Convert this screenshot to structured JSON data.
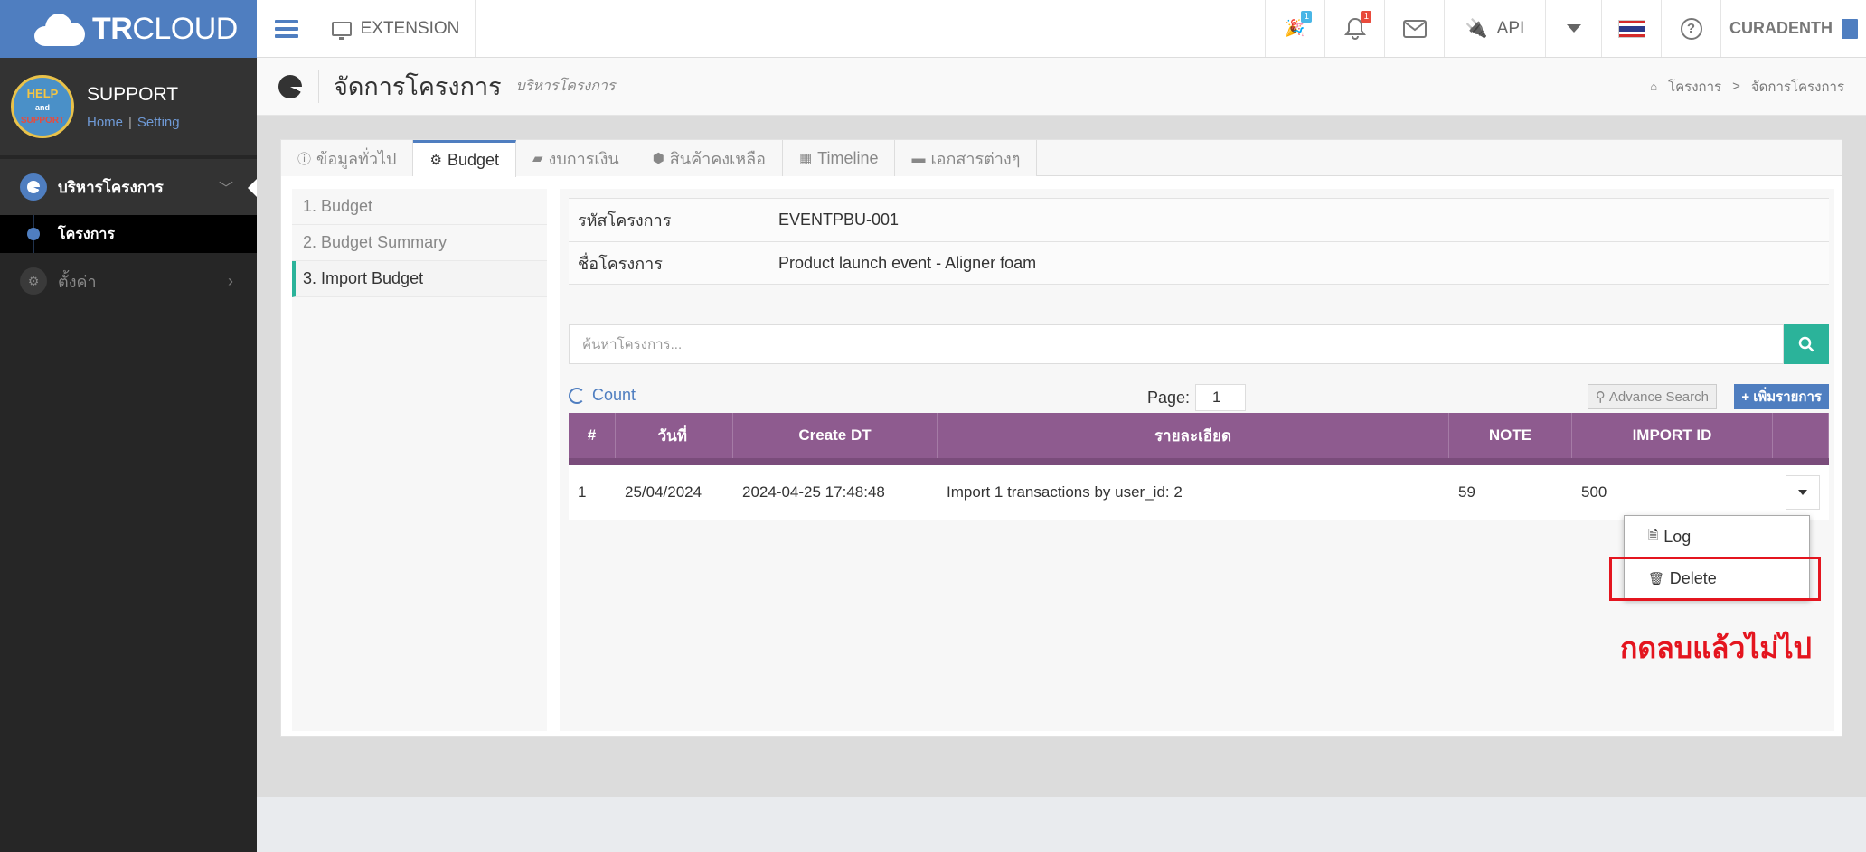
{
  "app": {
    "brand_bold": "TR",
    "brand_light": "CLOUD"
  },
  "profile": {
    "avatar_text_top": "HELP",
    "avatar_text_mid": "and",
    "avatar_text_bot": "SUPPORT",
    "name": "SUPPORT",
    "link_home": "Home",
    "link_sep": "|",
    "link_setting": "Setting"
  },
  "sidebar": {
    "items": [
      {
        "label": "บริหารโครงการ",
        "icon": "pie-icon"
      },
      {
        "label": "โครงการ",
        "icon": "dot-icon"
      },
      {
        "label": "ตั้งค่า",
        "icon": "gear-icon"
      }
    ]
  },
  "topbar": {
    "extension": "EXTENSION",
    "party_badge": "1",
    "bell_badge": "1",
    "api": "API",
    "user": "CURADENTH"
  },
  "pagehead": {
    "title": "จัดการโครงการ",
    "subtitle": "บริหารโครงการ",
    "crumbs": [
      "โครงการ",
      "จัดการโครงการ"
    ],
    "crumb_sep": ">"
  },
  "tabs": [
    {
      "label": "ข้อมูลทั่วไป",
      "icon": "info-icon"
    },
    {
      "label": "Budget",
      "icon": "gear-icon"
    },
    {
      "label": "งบการเงิน",
      "icon": "book-icon"
    },
    {
      "label": "สินค้าคงเหลือ",
      "icon": "cube-icon"
    },
    {
      "label": "Timeline",
      "icon": "calendar-icon"
    },
    {
      "label": "เอกสารต่างๆ",
      "icon": "folder-icon"
    }
  ],
  "steps": [
    "1. Budget",
    "2. Budget Summary",
    "3. Import Budget"
  ],
  "project": {
    "code_label": "รหัสโครงการ",
    "code_value": "EVENTPBU-001",
    "name_label": "ชื่อโครงการ",
    "name_value": "Product launch event - Aligner foam"
  },
  "search": {
    "placeholder": "ค้นหาโครงการ..."
  },
  "toolbar": {
    "count": "Count",
    "page_label": "Page:",
    "page_value": "1",
    "advance_search": "Advance Search",
    "add": "+ เพิ่มรายการ"
  },
  "table": {
    "headers": [
      "#",
      "วันที่",
      "Create DT",
      "รายละเอียด",
      "NOTE",
      "IMPORT ID",
      ""
    ],
    "rows": [
      [
        "1",
        "25/04/2024",
        "2024-04-25 17:48:48",
        "Import 1 transactions by user_id: 2",
        "59",
        "500"
      ]
    ]
  },
  "dropdown": {
    "log": "Log",
    "delete": "Delete"
  },
  "annotation": {
    "note": "กดลบแล้วไม่ไป"
  },
  "colors": {
    "brand": "#4f7ec0",
    "accent": "#2bb39a",
    "table_header": "#8e5b8f",
    "annotation_red": "#e4151f"
  }
}
